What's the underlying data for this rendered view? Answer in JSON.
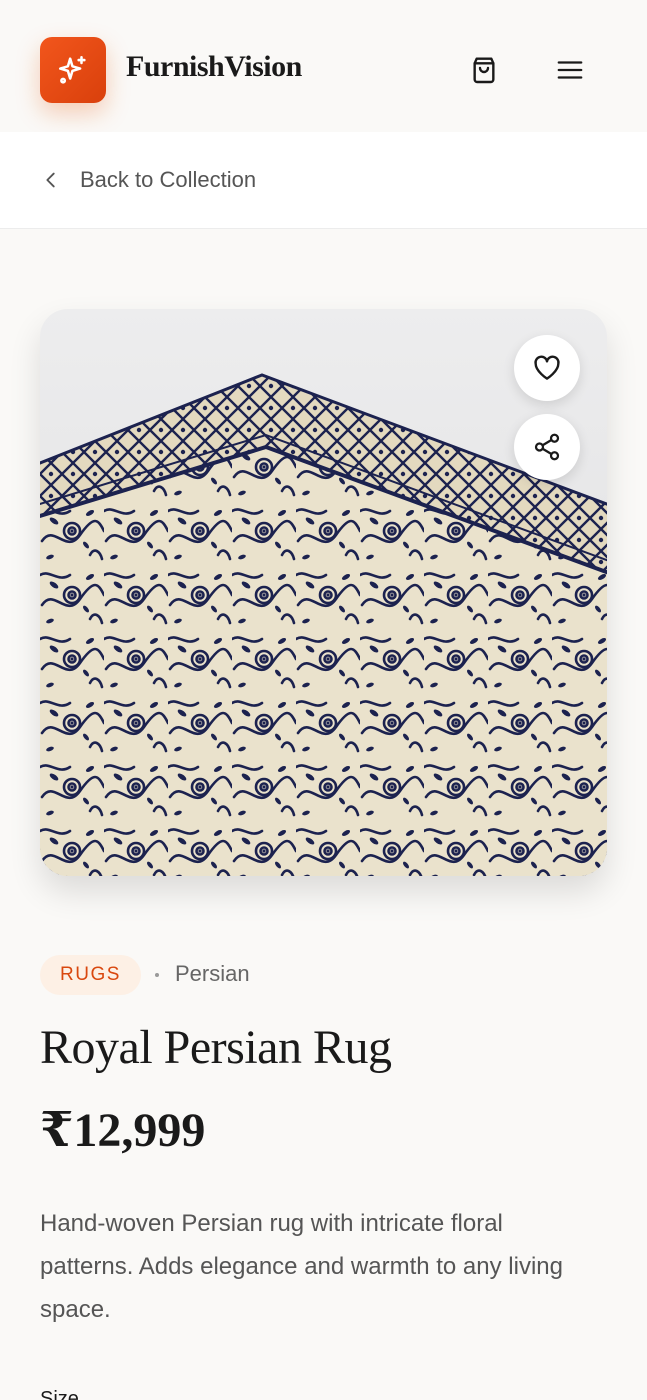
{
  "header": {
    "brand": "FurnishVision",
    "logo_icon": "sparkles-icon",
    "cart_icon": "shopping-bag-icon",
    "menu_icon": "hamburger-menu-icon"
  },
  "nav": {
    "back_label": "Back to Collection",
    "back_icon": "chevron-left-icon"
  },
  "product": {
    "image_alt": "Royal Persian Rug",
    "category": "RUGS",
    "subcategory": "Persian",
    "name": "Royal Persian Rug",
    "price": "₹12,999",
    "description": "Hand-woven Persian rug with intricate floral patterns. Adds elegance and warmth to any living space.",
    "size_label": "Size",
    "actions": {
      "favorite_icon": "heart-icon",
      "share_icon": "share-icon"
    }
  },
  "colors": {
    "accent": "#ea580c",
    "accent_bg": "#fdf0e5",
    "background": "#faf9f7",
    "rug_base": "#f2ead3",
    "rug_pattern": "#1d2452"
  }
}
